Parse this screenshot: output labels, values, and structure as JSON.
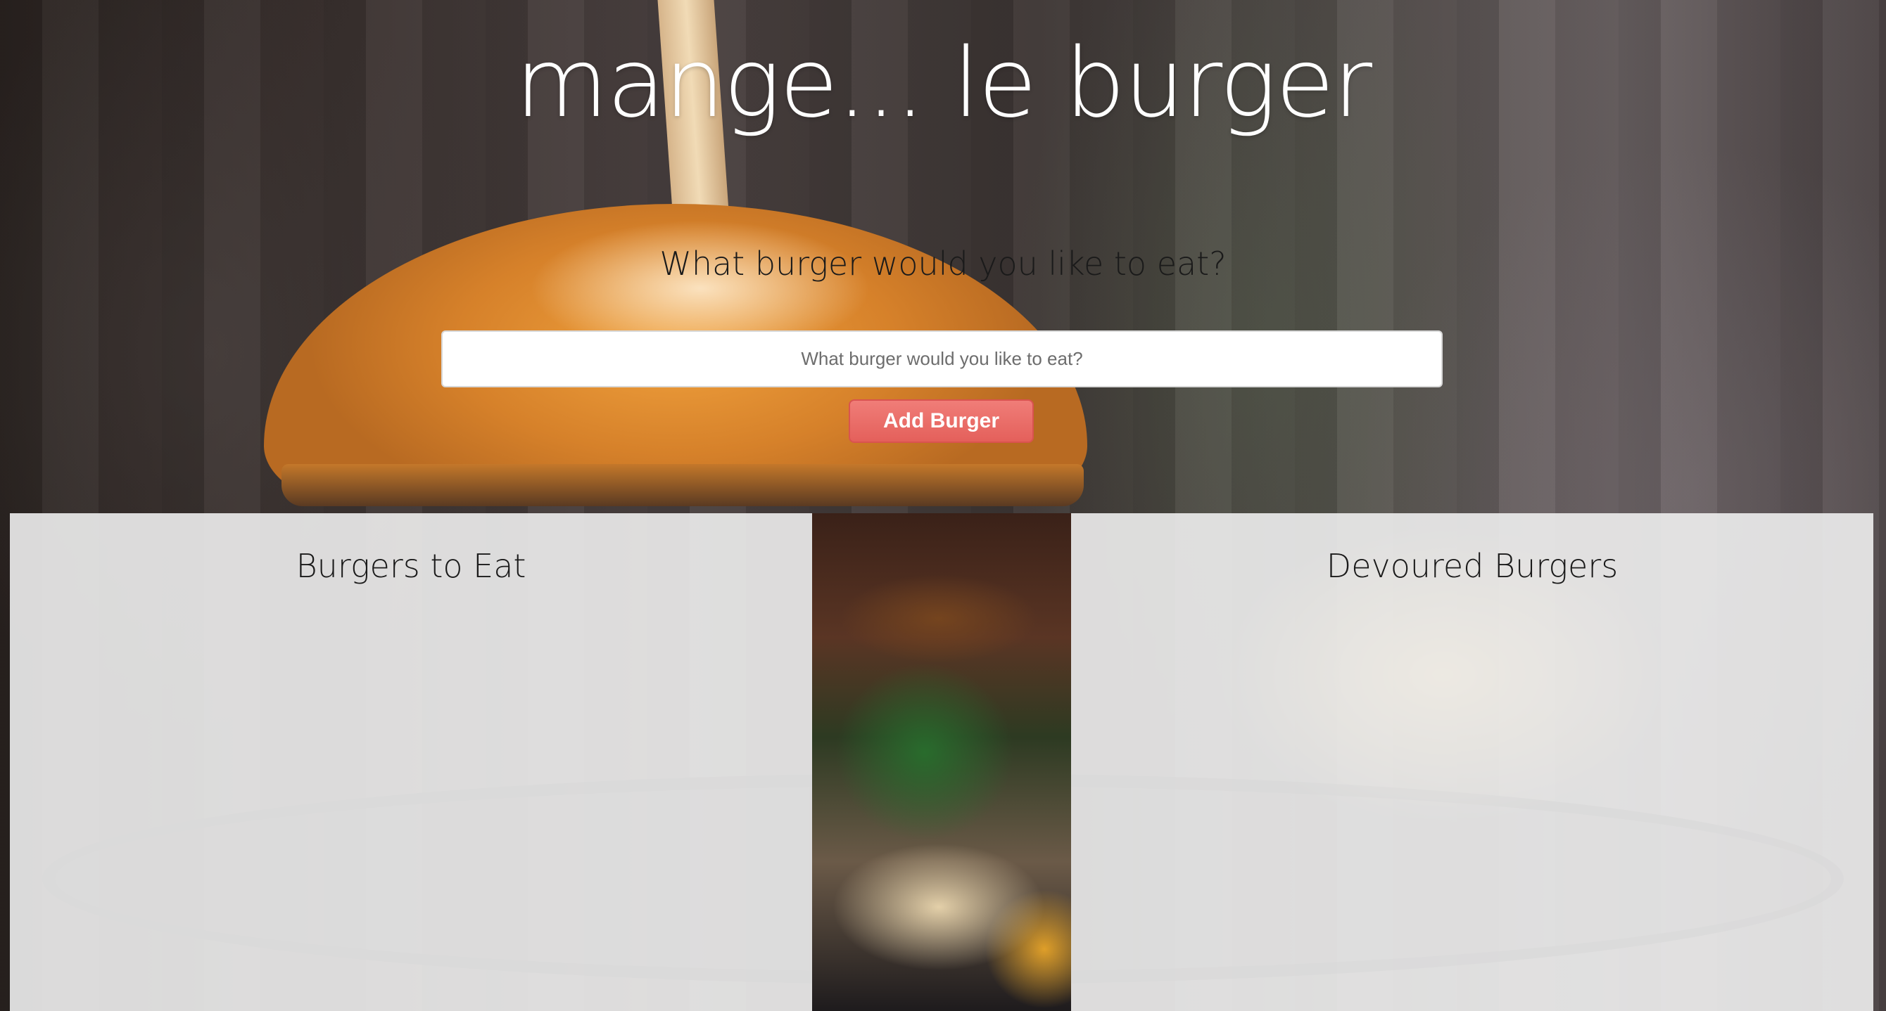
{
  "header": {
    "title": "mange... le burger"
  },
  "form": {
    "prompt": "What burger would you like to eat?",
    "input_placeholder": "What burger would you like to eat?",
    "input_value": "",
    "submit_label": "Add Burger"
  },
  "panels": {
    "to_eat": {
      "title": "Burgers to Eat",
      "items": []
    },
    "devoured": {
      "title": "Devoured Burgers",
      "items": []
    }
  },
  "colors": {
    "accent_button": "#e4605b",
    "panel_background": "#eeeeee",
    "title_text": "#ffffff"
  }
}
